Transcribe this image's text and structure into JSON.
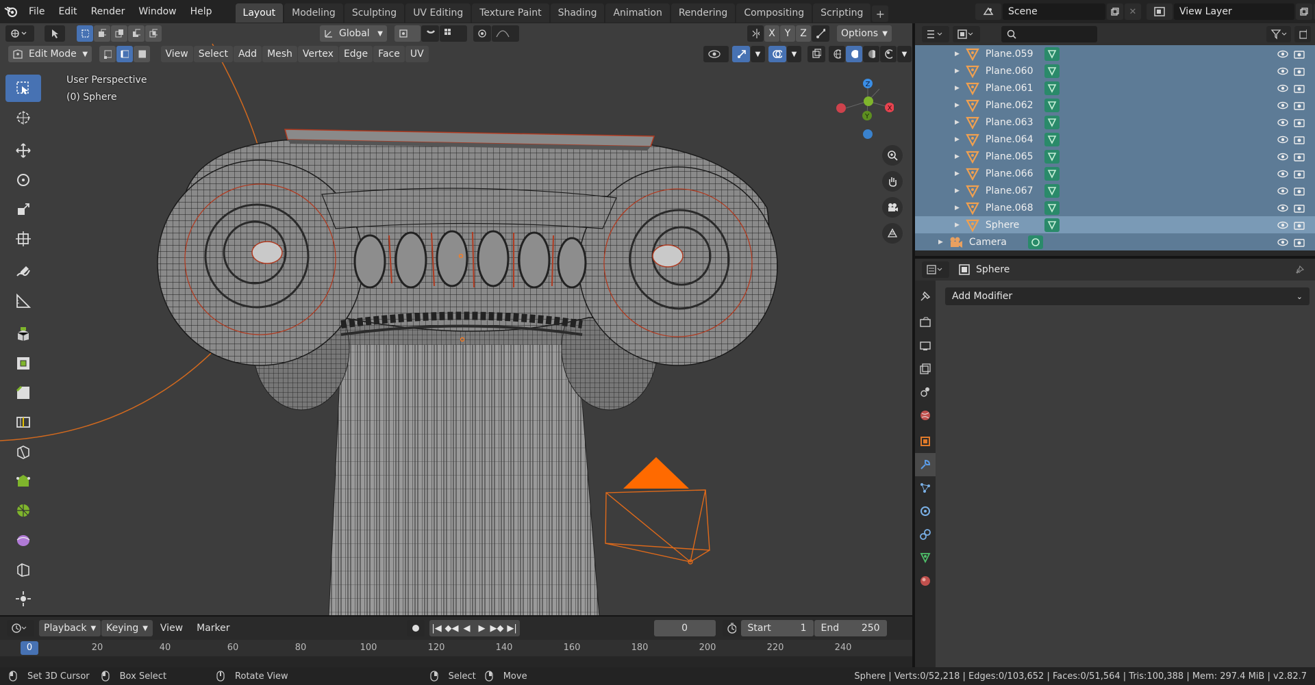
{
  "topbar": {
    "menus": [
      "File",
      "Edit",
      "Render",
      "Window",
      "Help"
    ],
    "workspaces": [
      "Layout",
      "Modeling",
      "Sculpting",
      "UV Editing",
      "Texture Paint",
      "Shading",
      "Animation",
      "Rendering",
      "Compositing",
      "Scripting"
    ],
    "active_workspace": "Layout",
    "add_workspace": "+",
    "scene_name": "Scene",
    "view_layer_name": "View Layer"
  },
  "viewport": {
    "orientation": "Global",
    "options_label": "Options",
    "axis_x": "X",
    "axis_y": "Y",
    "axis_z": "Z",
    "mode": "Edit Mode",
    "menus": [
      "View",
      "Select",
      "Add",
      "Mesh",
      "Vertex",
      "Edge",
      "Face",
      "UV"
    ],
    "perspective_label": "User Perspective",
    "object_label": "(0) Sphere",
    "gizmo": {
      "x": "X",
      "y": "Y",
      "z": "Z"
    }
  },
  "timeline": {
    "menus": [
      "Playback",
      "Keying",
      "View",
      "Marker"
    ],
    "current_frame": "0",
    "start_label": "Start",
    "start_value": "1",
    "end_label": "End",
    "end_value": "250",
    "ruler": [
      "0",
      "20",
      "40",
      "60",
      "80",
      "100",
      "120",
      "140",
      "160",
      "180",
      "200",
      "220",
      "240"
    ]
  },
  "statusbar": {
    "hints": [
      "Set 3D Cursor",
      "Box Select",
      "Rotate View",
      "Select",
      "Move"
    ],
    "stats": "Sphere | Verts:0/52,218 | Edges:0/103,652 | Faces:0/51,564 | Tris:100,388 | Mem: 297.4 MiB | v2.82.7"
  },
  "outliner": {
    "search_placeholder": "",
    "rows": [
      {
        "name": "Plane.059",
        "selected": true
      },
      {
        "name": "Plane.060",
        "selected": true
      },
      {
        "name": "Plane.061",
        "selected": true
      },
      {
        "name": "Plane.062",
        "selected": true
      },
      {
        "name": "Plane.063",
        "selected": true
      },
      {
        "name": "Plane.064",
        "selected": true
      },
      {
        "name": "Plane.065",
        "selected": true
      },
      {
        "name": "Plane.066",
        "selected": true
      },
      {
        "name": "Plane.067",
        "selected": true
      },
      {
        "name": "Plane.068",
        "selected": true
      },
      {
        "name": "Sphere",
        "selected": true,
        "active": true
      },
      {
        "name": "Camera",
        "selected": true,
        "type": "camera"
      }
    ]
  },
  "properties": {
    "object_name": "Sphere",
    "add_modifier_label": "Add Modifier"
  },
  "colors": {
    "accent": "#4772b3",
    "selection_orange": "#ff7a1a",
    "outliner_selected": "#5d7b96",
    "outliner_active": "#7a9ab6",
    "gizmo_x": "#e8434f",
    "gizmo_y": "#7fb52c",
    "gizmo_z": "#3a8ee6"
  }
}
